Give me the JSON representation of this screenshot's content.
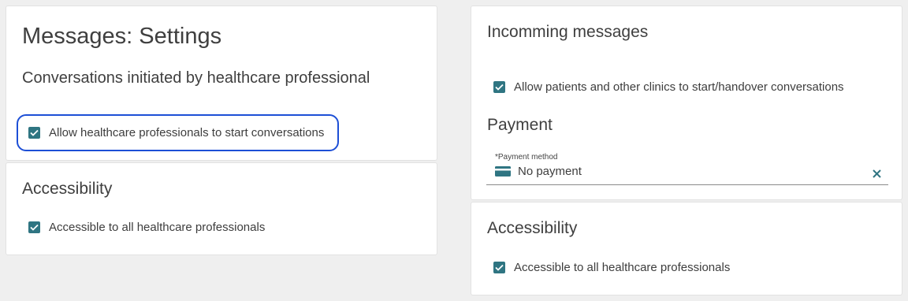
{
  "left": {
    "title": "Messages: Settings",
    "subtitle": "Conversations initiated by healthcare professional",
    "allow_hcp_start": {
      "label": "Allow healthcare professionals to start conversations",
      "checked": true
    },
    "accessibility": {
      "heading": "Accessibility",
      "checkbox": {
        "label": "Accessible to all healthcare professionals",
        "checked": true
      }
    }
  },
  "right": {
    "incoming": {
      "heading": "Incomming messages",
      "checkbox": {
        "label": "Allow patients and other clinics to start/handover conversations",
        "checked": true
      }
    },
    "payment": {
      "heading": "Payment",
      "field_label": "*Payment method",
      "field_value": "No payment",
      "field_icon": "credit-card-icon",
      "clear_icon": "close-icon"
    },
    "accessibility": {
      "heading": "Accessibility",
      "checkbox": {
        "label": "Accessible to all healthcare professionals",
        "checked": true
      }
    }
  },
  "colors": {
    "checkbox": "#2f7582",
    "focus_ring": "#1d4fd6",
    "clear_icon": "#2f7582",
    "background": "#efefef",
    "card": "#ffffff"
  }
}
